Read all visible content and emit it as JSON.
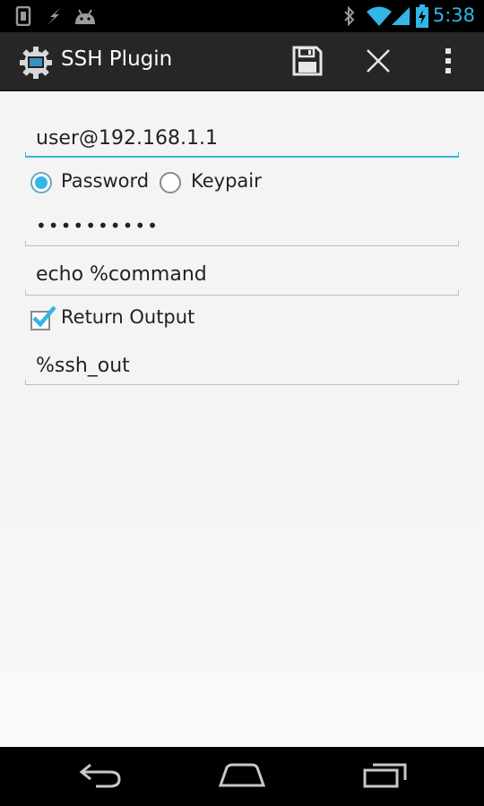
{
  "status_bar": {
    "time": "5:38",
    "icons": [
      "phone-notification-icon",
      "flash-icon",
      "android-icon",
      "bluetooth-icon",
      "wifi-icon",
      "signal-icon",
      "battery-charging-icon"
    ]
  },
  "action_bar": {
    "title": "SSH Plugin",
    "actions": [
      "save-icon",
      "close-icon",
      "overflow-menu-icon"
    ]
  },
  "form": {
    "host": "user@192.168.1.1",
    "auth": {
      "options": [
        "Password",
        "Keypair"
      ],
      "selected": "Password"
    },
    "password_mask": "••••••••••",
    "command": "echo %command",
    "return_output_label": "Return Output",
    "return_output_checked": true,
    "output_variable": "%ssh_out"
  },
  "nav_bar": {
    "buttons": [
      "back-icon",
      "home-icon",
      "recent-apps-icon"
    ]
  },
  "colors": {
    "accent": "#33b5e5",
    "action_bar": "#262626",
    "background": "#f4f4f4"
  }
}
